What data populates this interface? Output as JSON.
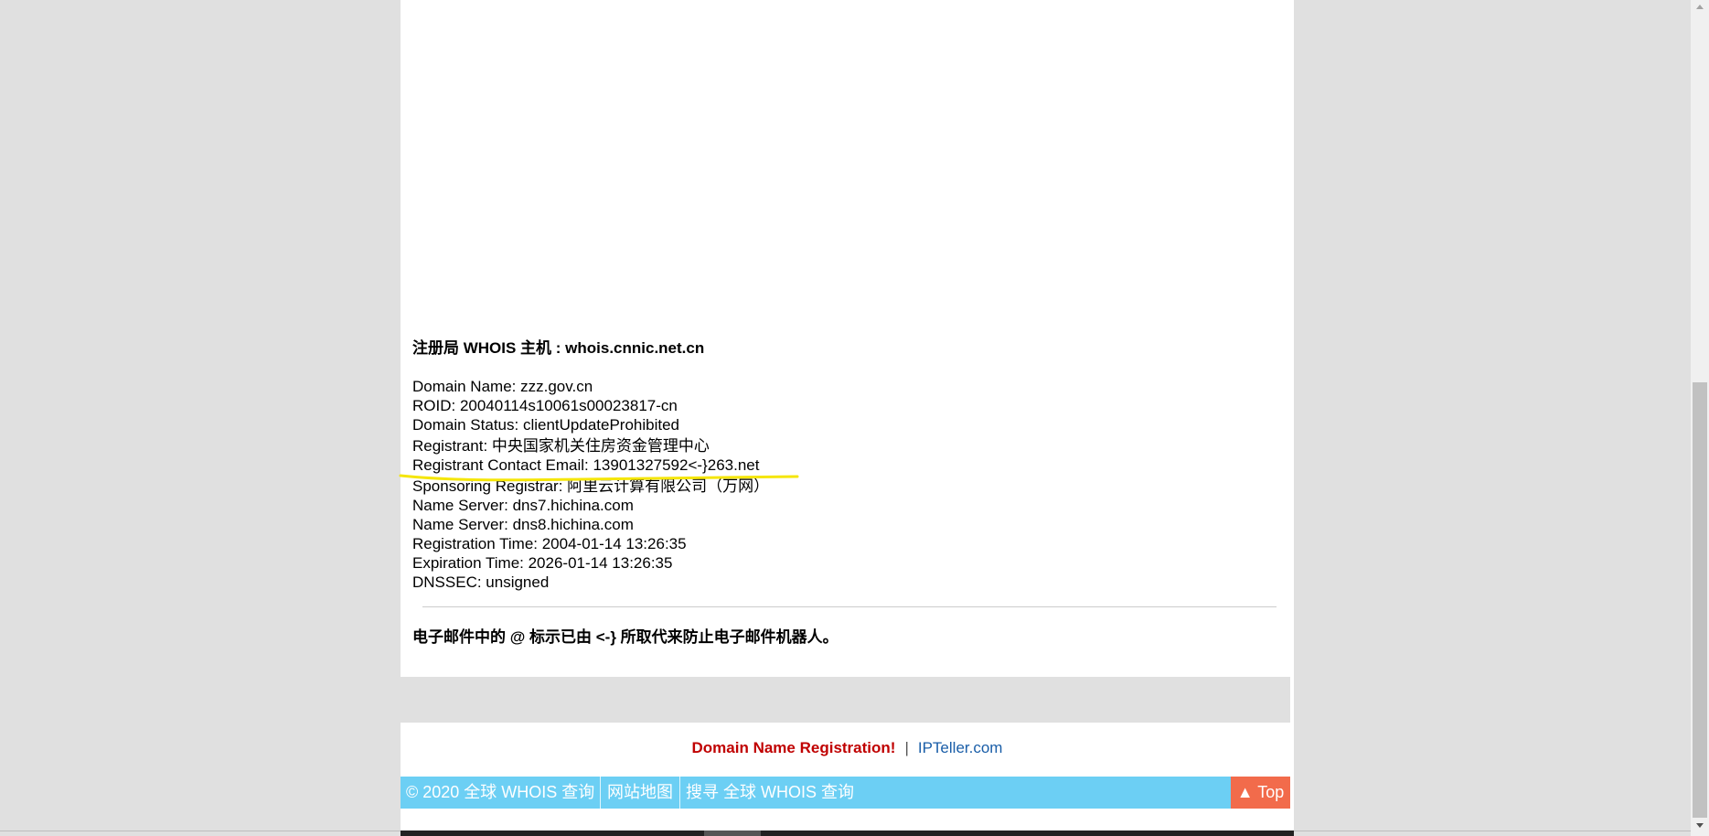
{
  "whois_host": {
    "text": "注册局 WHOIS 主机 : whois.cnnic.net.cn"
  },
  "record": [
    "Domain Name: zzz.gov.cn",
    "ROID: 20040114s10061s00023817-cn",
    "Domain Status: clientUpdateProhibited",
    "Registrant: 中央国家机关住房资金管理中心",
    "Registrant Contact Email: 13901327592<-}263.net",
    "Sponsoring Registrar: 阿里云计算有限公司（万网）",
    "Name Server: dns7.hichina.com",
    "Name Server: dns8.hichina.com",
    "Registration Time: 2004-01-14 13:26:35",
    "Expiration Time: 2026-01-14 13:26:35",
    "DNSSEC: unsigned"
  ],
  "email_note": "电子邮件中的 @ 标示已由 <-} 所取代来防止电子邮件机器人。",
  "links": {
    "registration": "Domain Name Registration!",
    "separator": "|",
    "ipteller": "IPTeller.com"
  },
  "footer": {
    "copyright": "© 2020 全球 WHOIS 查询",
    "sitemap": "网站地图",
    "search": "搜寻 全球 WHOIS 查询",
    "top": "▲ Top"
  },
  "colors": {
    "footer_bg": "#6ccff4",
    "top_button_bg": "#f26b4b",
    "registration_link": "#c00000",
    "ipteller_link": "#1a5ea8",
    "highlight_stroke": "#f5e60a"
  }
}
